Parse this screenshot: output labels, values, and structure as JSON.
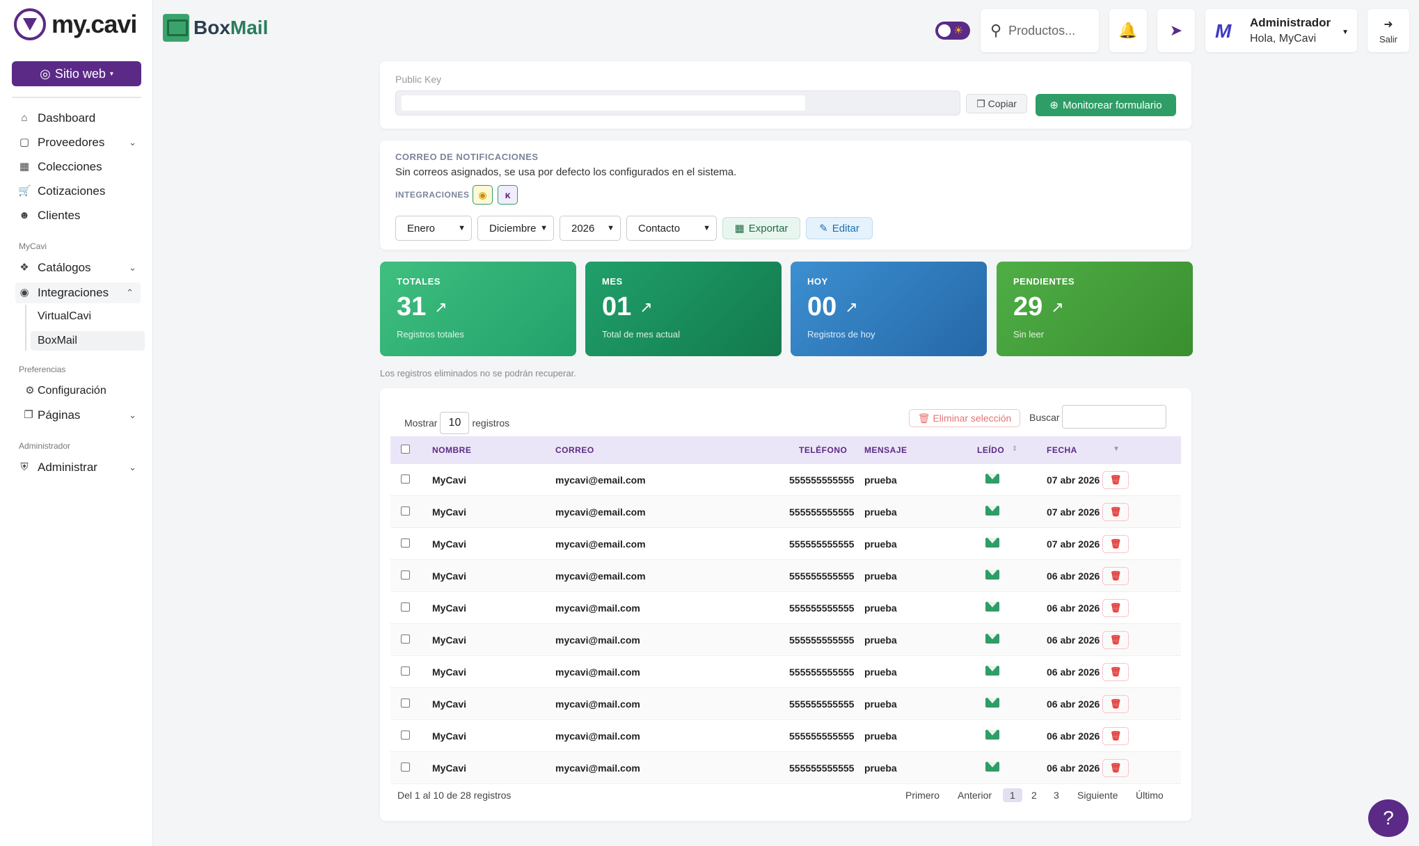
{
  "sidebar": {
    "logo_text": "my.cavi",
    "site_button": "Sitio web",
    "main_items": [
      {
        "label": "Dashboard",
        "icon": "home-icon"
      },
      {
        "label": "Proveedores",
        "icon": "box-icon"
      },
      {
        "label": "Colecciones",
        "icon": "grid-icon"
      },
      {
        "label": "Cotizaciones",
        "icon": "cart-icon"
      },
      {
        "label": "Clientes",
        "icon": "users-icon"
      }
    ],
    "section_mycavi": "MyCavi",
    "mycavi_items": [
      {
        "label": "Catálogos",
        "icon": "layers-icon"
      },
      {
        "label": "Integraciones",
        "icon": "plug-icon"
      }
    ],
    "sub_items": [
      "VirtualCavi",
      "BoxMail"
    ],
    "section_prefs": "Preferencias",
    "pref_items": [
      {
        "label": "Configuración",
        "icon": "gear-icon"
      },
      {
        "label": "Páginas",
        "icon": "pages-icon"
      }
    ],
    "section_admin": "Administrador",
    "admin_items": [
      {
        "label": "Administrar",
        "icon": "shield-icon"
      }
    ]
  },
  "header": {
    "brand_a": "Box",
    "brand_b": "Mail",
    "search_placeholder": "Productos...",
    "user_name": "Administrador",
    "user_greeting": "Hola, MyCavi",
    "logout": "Salir"
  },
  "public_key": {
    "label": "Public Key",
    "copy": "Copiar",
    "monitor": "Monitorear formulario"
  },
  "notifications": {
    "title": "CORREO DE NOTIFICACIONES",
    "description": "Sin correos asignados, se usa por defecto los configurados en el sistema.",
    "integrations_label": "INTEGRACIONES",
    "filters": {
      "month_from": "Enero",
      "month_to": "Diciembre",
      "year": "2026",
      "type": "Contacto"
    },
    "export": "Exportar",
    "edit": "Editar"
  },
  "stats": [
    {
      "label": "TOTALES",
      "value": "31",
      "sub": "Registros totales"
    },
    {
      "label": "MES",
      "value": "01",
      "sub": "Total de mes actual"
    },
    {
      "label": "HOY",
      "value": "00",
      "sub": "Registros de hoy"
    },
    {
      "label": "PENDIENTES",
      "value": "29",
      "sub": "Sin leer"
    }
  ],
  "warning": "Los registros eliminados no se podrán recuperar.",
  "table": {
    "show_label": "Mostrar",
    "show_value": "10",
    "records_label": "registros",
    "delete_selection": "Eliminar selección",
    "search_label": "Buscar",
    "headers": [
      "NOMBRE",
      "CORREO",
      "TELÉFONO",
      "MENSAJE",
      "LEÍDO",
      "FECHA"
    ],
    "rows": [
      {
        "name": "MyCavi",
        "email": "mycavi@email.com",
        "phone": "555555555555",
        "message": "prueba",
        "date": "07 abr 2026"
      },
      {
        "name": "MyCavi",
        "email": "mycavi@email.com",
        "phone": "555555555555",
        "message": "prueba",
        "date": "07 abr 2026"
      },
      {
        "name": "MyCavi",
        "email": "mycavi@email.com",
        "phone": "555555555555",
        "message": "prueba",
        "date": "07 abr 2026"
      },
      {
        "name": "MyCavi",
        "email": "mycavi@email.com",
        "phone": "555555555555",
        "message": "prueba",
        "date": "06 abr 2026"
      },
      {
        "name": "MyCavi",
        "email": "mycavi@mail.com",
        "phone": "555555555555",
        "message": "prueba",
        "date": "06 abr 2026"
      },
      {
        "name": "MyCavi",
        "email": "mycavi@mail.com",
        "phone": "555555555555",
        "message": "prueba",
        "date": "06 abr 2026"
      },
      {
        "name": "MyCavi",
        "email": "mycavi@mail.com",
        "phone": "555555555555",
        "message": "prueba",
        "date": "06 abr 2026"
      },
      {
        "name": "MyCavi",
        "email": "mycavi@mail.com",
        "phone": "555555555555",
        "message": "prueba",
        "date": "06 abr 2026"
      },
      {
        "name": "MyCavi",
        "email": "mycavi@mail.com",
        "phone": "555555555555",
        "message": "prueba",
        "date": "06 abr 2026"
      },
      {
        "name": "MyCavi",
        "email": "mycavi@mail.com",
        "phone": "555555555555",
        "message": "prueba",
        "date": "06 abr 2026"
      }
    ],
    "footer": "Del 1 al 10 de 28 registros",
    "pagination": [
      "Primero",
      "Anterior",
      "1",
      "2",
      "3",
      "Siguiente",
      "Último"
    ]
  },
  "help": "?"
}
